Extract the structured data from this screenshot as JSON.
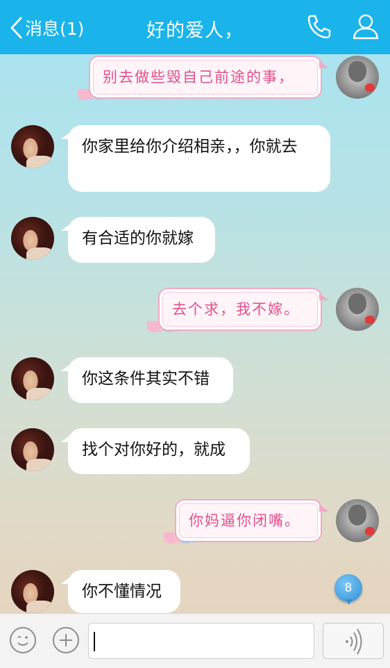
{
  "header": {
    "back_label": "消息(1)",
    "title": "好的爱人，",
    "bg_color": "#1ab3ea"
  },
  "messages": [
    {
      "side": "right",
      "text": "别去做些毁自己前途的事，"
    },
    {
      "side": "left",
      "text": "你家里给你介绍相亲，，你就去"
    },
    {
      "side": "left",
      "text": "有合适的你就嫁"
    },
    {
      "side": "right",
      "text": "去个求，我不嫁。"
    },
    {
      "side": "left",
      "text": "你这条件其实不错"
    },
    {
      "side": "left",
      "text": "找个对你好的，就成"
    },
    {
      "side": "right",
      "text": "你妈逼你闭嘴。"
    },
    {
      "side": "left",
      "text": "你不懂情况"
    }
  ],
  "badge": {
    "count": "8"
  },
  "input": {
    "value": "",
    "placeholder": ""
  },
  "icons": {
    "back": "chevron-left-icon",
    "phone": "phone-icon",
    "contact": "person-icon",
    "emoji": "smiley-icon",
    "plus": "plus-icon",
    "voice": "voice-wave-icon"
  }
}
